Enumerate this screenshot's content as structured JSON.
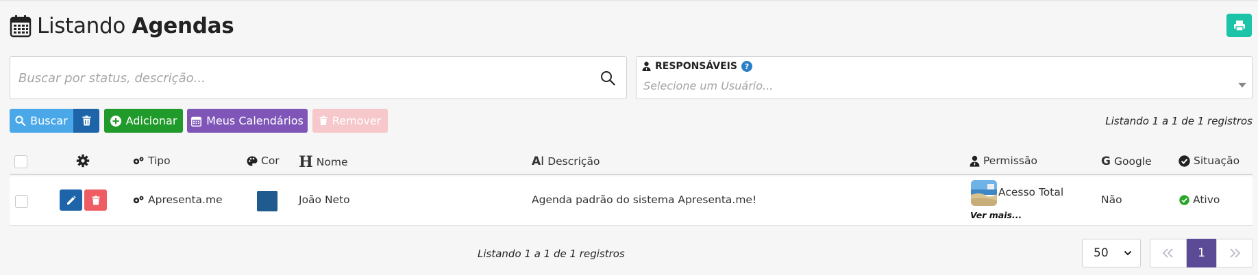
{
  "header": {
    "title_prefix": "Listando",
    "title_bold": "Agendas"
  },
  "search": {
    "placeholder": "Buscar por status, descrição..."
  },
  "responsaveis": {
    "label": "RESPONSÁVEIS",
    "placeholder": "Selecione um Usuário..."
  },
  "toolbar": {
    "buscar": "Buscar",
    "adicionar": "Adicionar",
    "meus_calendarios": "Meus Calendários",
    "remover": "Remover"
  },
  "listing_count": "Listando 1 a 1 de 1 registros",
  "table": {
    "headers": {
      "tipo": "Tipo",
      "cor": "Cor",
      "nome": "Nome",
      "descricao": "Descrição",
      "permissao": "Permissão",
      "google": "Google",
      "situacao": "Situação"
    },
    "rows": [
      {
        "tipo": "Apresenta.me",
        "cor": "#1f5b8e",
        "nome": "João Neto",
        "descricao": "Agenda padrão do sistema Apresenta.me!",
        "permissao": "Acesso Total",
        "ver_mais": "Ver mais...",
        "google": "Não",
        "situacao": "Ativo"
      }
    ]
  },
  "pagination": {
    "per_page": "50",
    "current_page": "1"
  },
  "colors": {
    "primary": "#1d64a8",
    "info": "#4aa8e9",
    "success": "#209a2a",
    "purple": "#7f56b8",
    "danger_light": "#f6c8cb",
    "danger": "#ee5d63",
    "teal": "#1cc3a6",
    "pager_active": "#5b4a95"
  }
}
